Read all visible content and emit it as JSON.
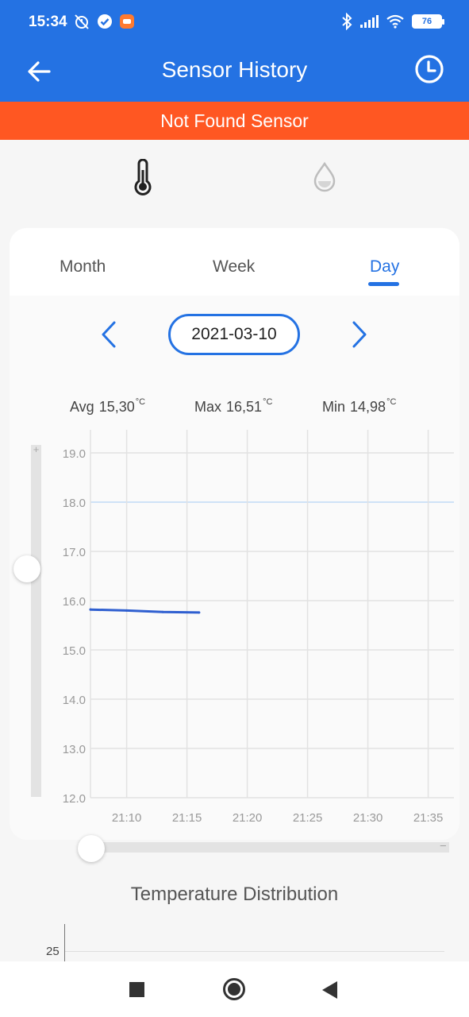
{
  "status_bar": {
    "time": "15:34",
    "battery": "76",
    "left_icons": [
      "muted-alarm-icon",
      "verified-check-icon",
      "app-notification-icon"
    ],
    "right_icons": [
      "bluetooth-icon",
      "signal-icon",
      "wifi-icon",
      "battery-icon"
    ]
  },
  "app_bar": {
    "title": "Sensor History",
    "back_icon": "arrow-left-icon",
    "history_icon": "clock-icon",
    "color": "#2472e3"
  },
  "alert": {
    "text": "Not Found Sensor",
    "color": "#ff5722"
  },
  "sensor_tabs": [
    {
      "icon": "thermometer-icon",
      "selected": true
    },
    {
      "icon": "humidity-drop-icon",
      "selected": false
    }
  ],
  "periods": {
    "month": "Month",
    "week": "Week",
    "day": "Day",
    "selected": "Day"
  },
  "date": "2021-03-10",
  "stats": {
    "avg_label": "Avg",
    "avg_value": "15,30",
    "max_label": "Max",
    "max_value": "16,51",
    "min_label": "Min",
    "min_value": "14,98",
    "unit": "°C"
  },
  "chart_data": {
    "type": "line",
    "x": [
      "21:07",
      "21:10",
      "21:13",
      "21:16"
    ],
    "series": [
      {
        "values": [
          15.82,
          15.8,
          15.77,
          15.76
        ],
        "color": "#2f5fd0"
      }
    ],
    "xticks": [
      "21:10",
      "21:15",
      "21:20",
      "21:25",
      "21:30",
      "21:35"
    ],
    "yticks": [
      "12.0",
      "13.0",
      "14.0",
      "15.0",
      "16.0",
      "17.0",
      "18.0",
      "19.0"
    ],
    "ylim": [
      12.0,
      19.5
    ],
    "highlight_line": 18.0,
    "grid": true
  },
  "distribution": {
    "title": "Temperature Distribution",
    "ytick": "25"
  }
}
